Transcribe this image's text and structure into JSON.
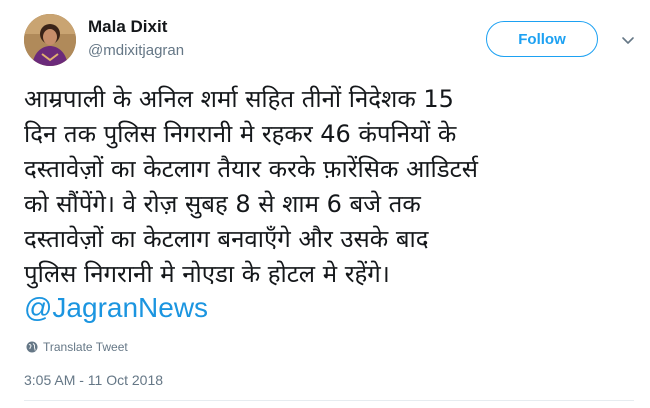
{
  "author": {
    "name": "Mala Dixit",
    "handle": "@mdixitjagran",
    "avatar_icon": "user-photo"
  },
  "follow_button": {
    "label": "Follow"
  },
  "menu": {
    "icon": "chevron-down-icon"
  },
  "tweet": {
    "lines": [
      "आम्रपाली के अनिल शर्मा सहित तीनों निदेशक 15",
      "दिन तक पुलिस निगरानी मे रहकर 46 कंपनियों के",
      "दस्तावेज़ों का केटलाग तैयार करके फ़ारेंसिक आडिटर्स",
      "को सौंपेंगे। वे रोज़ सुबह 8 से शाम 6 बजे तक",
      "दस्तावेज़ों का केटलाग बनवाएँगे और उसके बाद",
      "पुलिस निगरानी मे नोएडा के होटल मे रहेंगे।"
    ],
    "mention": "@JagranNews"
  },
  "translate": {
    "label": "Translate Tweet",
    "icon": "globe-icon"
  },
  "timestamp": "3:05 AM - 11 Oct 2018",
  "colors": {
    "accent": "#1da1f2",
    "link": "#1b95e0",
    "muted": "#657786",
    "text": "#14171a"
  }
}
